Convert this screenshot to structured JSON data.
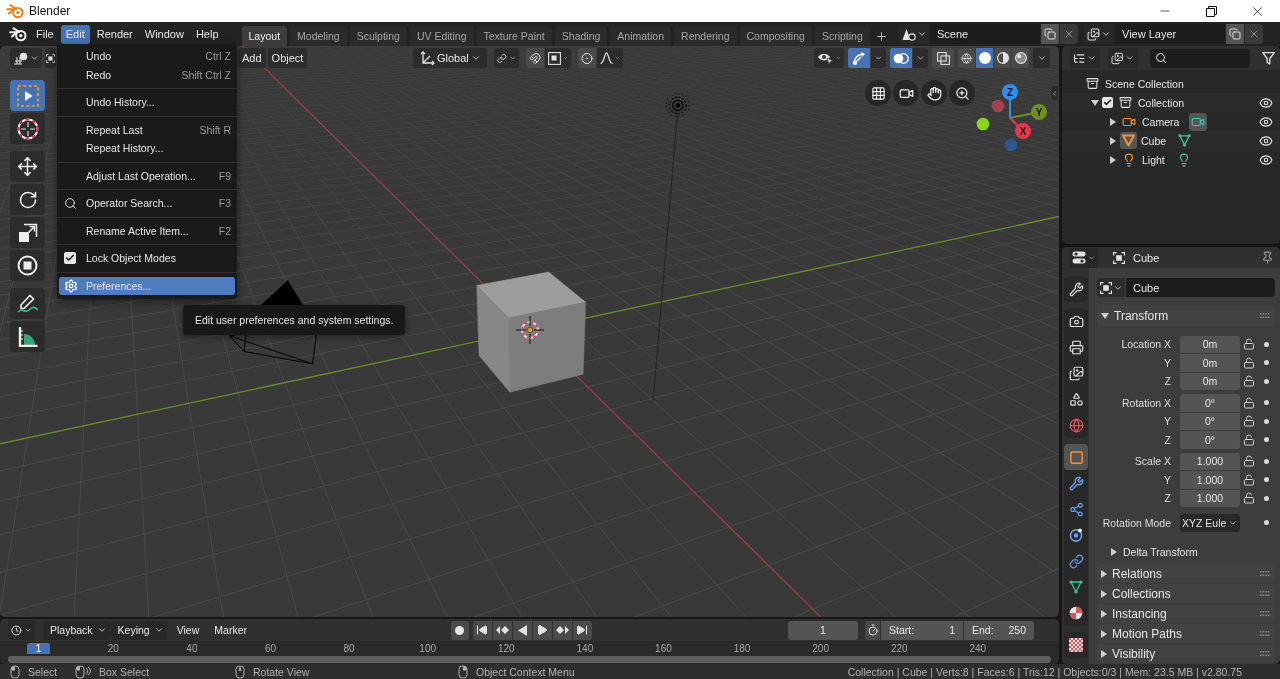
{
  "window": {
    "title": "Blender"
  },
  "menu_bar": [
    {
      "label": "File",
      "selected": false
    },
    {
      "label": "Edit",
      "selected": true
    },
    {
      "label": "Render",
      "selected": false
    },
    {
      "label": "Window",
      "selected": false
    },
    {
      "label": "Help",
      "selected": false
    }
  ],
  "workspace_tabs": [
    {
      "label": "Layout",
      "selected": true
    },
    {
      "label": "Modeling",
      "selected": false
    },
    {
      "label": "Sculpting",
      "selected": false
    },
    {
      "label": "UV Editing",
      "selected": false
    },
    {
      "label": "Texture Paint",
      "selected": false
    },
    {
      "label": "Shading",
      "selected": false
    },
    {
      "label": "Animation",
      "selected": false
    },
    {
      "label": "Rendering",
      "selected": false
    },
    {
      "label": "Compositing",
      "selected": false
    },
    {
      "label": "Scripting",
      "selected": false
    }
  ],
  "scene": "Scene",
  "view_layer": "View Layer",
  "viewport": {
    "header_menus": [
      "Add",
      "Object"
    ],
    "orientation": "Global",
    "transform_toggles": [
      {
        "kind": "snap",
        "on": false
      },
      {
        "kind": "proportional",
        "on": false
      }
    ],
    "display_toggles": [
      {
        "kind": "gizmos",
        "on": true
      },
      {
        "kind": "overlays",
        "on": true
      },
      {
        "kind": "xray",
        "on": false
      }
    ],
    "shading": [
      {
        "kind": "wireframe",
        "selected": false
      },
      {
        "kind": "solid",
        "selected": true
      },
      {
        "kind": "material",
        "selected": false
      },
      {
        "kind": "rendered",
        "selected": false
      }
    ],
    "tools": [
      [
        {
          "kind": "select_box",
          "selected": true
        },
        {
          "kind": "cursor",
          "selected": false
        }
      ],
      [
        {
          "kind": "move",
          "selected": false
        },
        {
          "kind": "rotate",
          "selected": false
        },
        {
          "kind": "scale",
          "selected": false
        },
        {
          "kind": "transform",
          "selected": false
        }
      ],
      [
        {
          "kind": "annotate",
          "selected": false
        },
        {
          "kind": "measure",
          "selected": false
        }
      ]
    ],
    "axes": [
      {
        "label": "X",
        "color": "#e8364f"
      },
      {
        "label": "Y",
        "color": "#6e8e20"
      },
      {
        "label": "Z",
        "color": "#2e8ff0"
      }
    ]
  },
  "edit_menu": {
    "groups": [
      [
        {
          "label": "Undo",
          "shortcut": "Ctrl Z",
          "kind": "plain",
          "selected": false
        },
        {
          "label": "Redo",
          "shortcut": "Shift Ctrl Z",
          "kind": "plain",
          "selected": false
        }
      ],
      [
        {
          "label": "Undo History...",
          "kind": "plain",
          "selected": false
        }
      ],
      [
        {
          "label": "Repeat Last",
          "shortcut": "Shift R",
          "kind": "plain",
          "selected": false
        },
        {
          "label": "Repeat History...",
          "kind": "plain",
          "selected": false
        }
      ],
      [
        {
          "label": "Adjust Last Operation...",
          "shortcut": "F9",
          "kind": "plain",
          "selected": false
        }
      ],
      [
        {
          "label": "Operator Search...",
          "shortcut": "F3",
          "kind": "search",
          "selected": false
        }
      ],
      [
        {
          "label": "Rename Active Item...",
          "shortcut": "F2",
          "kind": "plain",
          "selected": false
        }
      ],
      [
        {
          "label": "Lock Object Modes",
          "kind": "checkbox",
          "checked": true,
          "selected": false
        }
      ],
      [
        {
          "label": "Preferences...",
          "kind": "preferences",
          "selected": true
        }
      ]
    ]
  },
  "tooltip": "Edit user preferences and system settings.",
  "outliner": {
    "tree": {
      "label": "Scene Collection",
      "kind": "scene_collection",
      "children": [
        {
          "label": "Collection",
          "kind": "collection",
          "expanded": true,
          "checked": true,
          "visible": true,
          "children": [
            {
              "label": "Camera",
              "kind": "camera",
              "expanded": false,
              "visible": true,
              "active": false,
              "data_active": true
            },
            {
              "label": "Cube",
              "kind": "mesh",
              "expanded": false,
              "visible": true,
              "active": true,
              "data_active": false
            },
            {
              "label": "Light",
              "kind": "light",
              "expanded": false,
              "visible": true,
              "active": false,
              "data_active": false
            }
          ]
        }
      ]
    }
  },
  "properties": {
    "context": "Cube",
    "tab_groups": [
      [
        {
          "kind": "tool",
          "selected": false
        }
      ],
      [
        {
          "kind": "render",
          "selected": false
        },
        {
          "kind": "output",
          "selected": false
        },
        {
          "kind": "view_layer",
          "selected": false
        },
        {
          "kind": "scene",
          "selected": false
        },
        {
          "kind": "world",
          "selected": false
        }
      ],
      [
        {
          "kind": "object",
          "selected": true
        },
        {
          "kind": "modifiers",
          "selected": false
        },
        {
          "kind": "particles",
          "selected": false
        },
        {
          "kind": "physics",
          "selected": false
        },
        {
          "kind": "constraints",
          "selected": false
        },
        {
          "kind": "data",
          "selected": false
        },
        {
          "kind": "material",
          "selected": false
        }
      ],
      [
        {
          "kind": "texture",
          "selected": false
        }
      ]
    ],
    "name": "Cube",
    "transform": {
      "title": "Transform",
      "expanded": true,
      "groups": [
        [
          {
            "label": "Location X",
            "value": "0m",
            "locked": false
          },
          {
            "label": "Y",
            "value": "0m",
            "locked": false
          },
          {
            "label": "Z",
            "value": "0m",
            "locked": false
          }
        ],
        [
          {
            "label": "Rotation X",
            "value": "0°",
            "locked": false
          },
          {
            "label": "Y",
            "value": "0°",
            "locked": false
          },
          {
            "label": "Z",
            "value": "0°",
            "locked": false
          }
        ],
        [
          {
            "label": "Scale X",
            "value": "1.000",
            "locked": false
          },
          {
            "label": "Y",
            "value": "1.000",
            "locked": false
          },
          {
            "label": "Z",
            "value": "1.000",
            "locked": false
          }
        ]
      ],
      "rotation_mode": {
        "label": "Rotation Mode",
        "value": "XYZ Eule"
      },
      "subpanel": {
        "title": "Delta Transform",
        "expanded": false
      }
    },
    "panels": [
      {
        "title": "Relations",
        "expanded": false
      },
      {
        "title": "Collections",
        "expanded": false
      },
      {
        "title": "Instancing",
        "expanded": false
      },
      {
        "title": "Motion Paths",
        "expanded": false
      },
      {
        "title": "Visibility",
        "expanded": false
      }
    ]
  },
  "timeline": {
    "menus": [
      {
        "label": "Playback",
        "kind": "dropdown"
      },
      {
        "label": "Keying",
        "kind": "dropdown"
      },
      {
        "label": "View",
        "kind": "menu"
      },
      {
        "label": "Marker",
        "kind": "menu"
      }
    ],
    "auto_keying": false,
    "current_frame": "1",
    "start_label": "Start:",
    "start": "1",
    "end_label": "End:",
    "end": "250",
    "playhead": "1",
    "ruler": [
      "20",
      "40",
      "60",
      "80",
      "100",
      "120",
      "140",
      "160",
      "180",
      "200",
      "220",
      "240"
    ]
  },
  "status_bar": {
    "hints": [
      {
        "kind": "left_click",
        "label": "Select"
      },
      {
        "kind": "left_drag",
        "label": "Box Select"
      },
      {
        "kind": "middle_drag",
        "label": "Rotate View"
      },
      {
        "kind": "right_click",
        "label": "Object Context Menu"
      }
    ],
    "stats": "Collection | Cube | Verts:8 | Faces:6 | Tris:12 | Objects:0/3 | Mem: 23.5 MB | v2.80.75"
  }
}
